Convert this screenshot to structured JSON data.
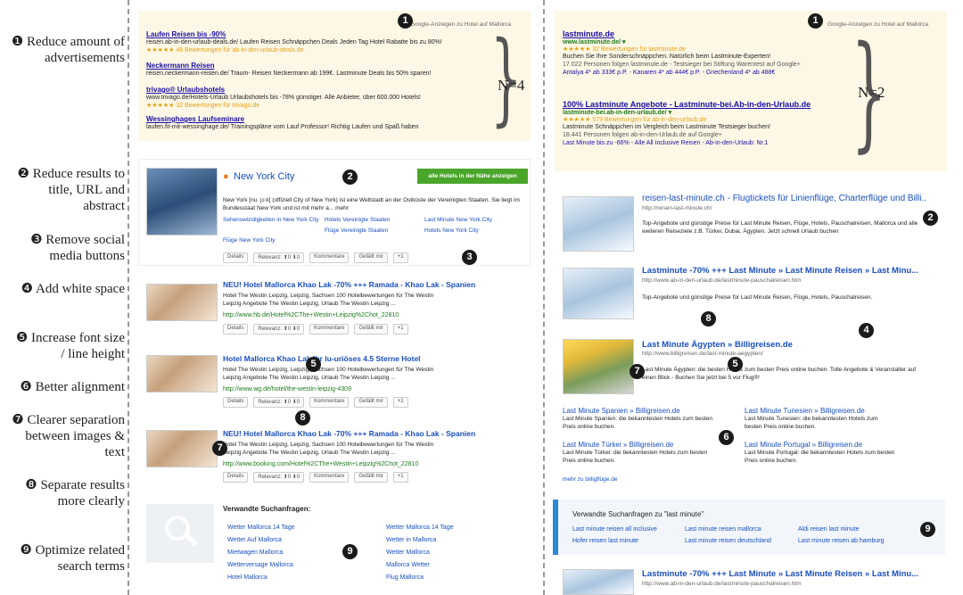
{
  "labels": [
    {
      "n": "❶",
      "text": "Reduce amount of advertisements"
    },
    {
      "n": "❷",
      "text": "Reduce results to title, URL and abstract"
    },
    {
      "n": "❸",
      "text": "Remove social media buttons"
    },
    {
      "n": "❹",
      "text": "Add white space"
    },
    {
      "n": "❺",
      "text": "Increase font size / line height"
    },
    {
      "n": "❻",
      "text": "Better alignment"
    },
    {
      "n": "❼",
      "text": "Clearer separation between images & text"
    },
    {
      "n": "❽",
      "text": "Separate results more clearly"
    },
    {
      "n": "❾",
      "text": "Optimize related search terms"
    }
  ],
  "left": {
    "ads_header": "Google-Anzeigen zu Hotel auf Mallorca",
    "ads": [
      {
        "title": "Laufen Reisen bis -90%",
        "line": "reisen.ab-in-den-urlaub-deals.de/  Laufen Reisen Schnäppchen Deals Jeden Tag Hotel Rabatte bis zu 80%!",
        "stars": "★★★★★ 48 Bewertungen für ab-in-den-urlaub-deals.de"
      },
      {
        "title": "Neckermann Reisen",
        "line": "reisen.neckermann-reisen.de/  Traum- Reisen Neckermann ab 199€. Lastminute Deals bis 50% sparen!",
        "stars": ""
      },
      {
        "title": "trivago® Urlaubshotels",
        "line": "www.trivago.de/Hotels-Urlaub  Urlaubshotels bis -78% günstiger. Alle Anbieter, über 600.000 Hotels!",
        "stars": "★★★★★ 32 Bewertungen für trivago.de"
      },
      {
        "title": "Wessinghages Laufseminare",
        "line": "laufen.fit-mit-wessinghage.de/  Trainingspläne vom Lauf Professor! Richtig Laufen und Spaß haben",
        "stars": ""
      }
    ],
    "n_label": "N=4",
    "city_title": "New York City",
    "city_button": "alle Hotels in der Nähe anzeigen",
    "city_text": "New York [nuː jɔːk] (offiziell City of New York) ist eine Weltstadt an der Ostküste der Vereinigten Staaten. Sie liegt im Bundesstaat New York und ist mit mehr a...  mehr",
    "city_links": [
      "Sehenswürdigkeiten in New York City",
      "Hotels Vereinigte Staaten",
      "Last Minute New York City",
      "Flüge New York City",
      "Flüge Vereinigte Staaten",
      "Hotels New York City"
    ],
    "btns": [
      "Details",
      "Relevanz: ⬆0 ⬇0",
      "Kommentare",
      "Gefällt mir",
      "+1"
    ],
    "results": [
      {
        "title": "NEU! Hotel Mallorca Khao Lak -70% +++ Ramada - Khao Lak - Spanien",
        "desc": "Hotel The Westin Leipzig, Leipzig, Sachsen 100 Hotelbewertungen für The Westin Leipzig Angebote The Westin Leipzig, Urlaub The Westin Leipzig ...",
        "url": "http://www.hb.de/Hotel%2CThe+Westin+Leipzig%2Chot_22810"
      },
      {
        "title": "Hotel Mallorca Khao Lak Ihr Iu-uriöses 4.5 Sterne Hotel",
        "desc": "Hotel The Westin Leipzig, Leipzig, Sachsen 100 Hotelbewertungen für The Westin Leipzig Angebote The Westin Leipzig, Urlaub The Westin Leipzig ...",
        "url": "http://www.wg.de/hotel/the-westin-leipzig-4309"
      },
      {
        "title": "NEU! Hotel Mallorca Khao Lak -70% +++ Ramada - Khao Lak - Spanien",
        "desc": "Hotel The Westin Leipzig, Leipzig, Sachsen 100 Hotelbewertungen für The Westin Leipzig Angebote The Westin Leipzig, Urlaub The Westin Leipzig ...",
        "url": "http://www.booking.com/Hotel%2CThe+Westin+Leipzig%2Chot_22810"
      }
    ],
    "related_title": "Verwandte Suchanfragen:",
    "related": [
      "Wetter Mallorca 14 Tage",
      "Wetter Mallorca 14 Tage",
      "Wetter Auf Mallorca",
      "Wetter in Mallorca",
      "Mietwagen Mallorca",
      "Wetter Mallorca",
      "Wetterversage Mallorca",
      "Mallorca Wetter",
      "Hotel Mallorca",
      "Flug Mallorca"
    ]
  },
  "right": {
    "ads_header": "Google-Anzeigen zu Hotel auf Mallorca",
    "ads": [
      {
        "title": "lastminute.de",
        "url": "www.lastminute.de/ ▾",
        "stars": "★★★★★ 32 Bewertungen für lastminute.de",
        "l1": "Buchen Sie Ihre Sonderschnäppchen. Natürlich beim Lastminute-Experten!",
        "l2": "17.022 Personen folgen lastminute.de - Testsieger bei Stiftung Warentest auf Google+",
        "l3": "Antalya 4* ab 333€ p.P. - Kanaren 4* ab 444€ p.P. - Griechenland 4* ab 488€"
      },
      {
        "title": "100% Lastminute Angebote - Lastminute-bei.Ab-in-den-Urlaub.de",
        "url": "lastminute-bei.ab-in-den-urlaub.de/ ▾",
        "stars": "★★★★★ 579 Bewertungen für ab-in-den-urlaub.de",
        "l1": "Lastminute Schnäppchen im Vergleich beim Lastminute Testsieger buchen!",
        "l2": "18.441 Personen folgen ab-in-den-Urlaub.de auf Google+",
        "l3": "Last Minute bis zu -66% - Alle All Inclusive Reisen - Ab-in-den-Urlaub: Nr.1"
      }
    ],
    "n_label": "N=2",
    "results": [
      {
        "title": "reisen-last-minute.ch - Flugtickets für Linienflüge, Charterflüge und Billi...",
        "url": "http://reisen-last-minute.ch/",
        "desc": "Top-Angebote und günstige Preise für Last Minute Reisen, Flüge, Hotels, Pauschalreisen, Mallorca und alle weiteren Reiseziele z.B. Türkei, Dubai, Ägypten. Jetzt schnell Urlaub buchen"
      },
      {
        "title": "Lastminute -70% +++ Last Minute » Last Minute Reisen » Last Minu...",
        "url": "http://www.ab-in-den-urlaub.de/lastminute-pauschalreisen.htm",
        "desc": "Top-Angebote und günstige Preise für Last Minute Reisen, Flüge, Hotels, Pauschalreisen."
      },
      {
        "title": "Last Minute Ägypten » Billigreisen.de",
        "url": "http://www.billigreisen.de/last-minute-aegypten/",
        "desc": "Last Minute Ägypten: die besten Hotels zum besten Preis online buchen. Tolle Angebote & Veranstalter auf einen Blick - Buchen Sie jetzt bei 5 vor Flug®!"
      }
    ],
    "sub": [
      {
        "title": "Last Minute Spanien » Billigreisen.de",
        "desc": "Last Minute Spanien: die bekanntesten Hotels zum besten Preis online buchen."
      },
      {
        "title": "Last Minute Tunesien » Billigreisen.de",
        "desc": "Last Minute Tunesien: die bekanntesten Hotels zum besten Preis online buchen."
      },
      {
        "title": "Last Minute Türkei » Billigreisen.de",
        "desc": "Last Minute Türkei: die bekanntesten Hotels zum besten Preis online buchen."
      },
      {
        "title": "Last Minute Portugal » Billigreisen.de",
        "desc": "Last Minute Portugal: die bekanntesten Hotels zum besten Preis online buchen."
      }
    ],
    "more": "mehr zu billigflüge.de",
    "related_title": "Verwandte Suchanfragen zu \"last minute\"",
    "related": [
      "Last minute reisen all inclusive",
      "Last minute reisen mallorca",
      "Aldi reisen last minute",
      "Hofer reisen last minute",
      "Last minute reisen deutschland",
      "Last minute reisen ab hamburg"
    ],
    "last": {
      "title": "Lastminute -70% +++ Last Minute » Last Minute Reisen » Last Minu...",
      "url": "http://www.ab-in-den-urlaub.de/lastminute-pauschalreisen.htm"
    }
  },
  "markers": [
    "1",
    "2",
    "3",
    "4",
    "5",
    "6",
    "7",
    "8",
    "9"
  ]
}
